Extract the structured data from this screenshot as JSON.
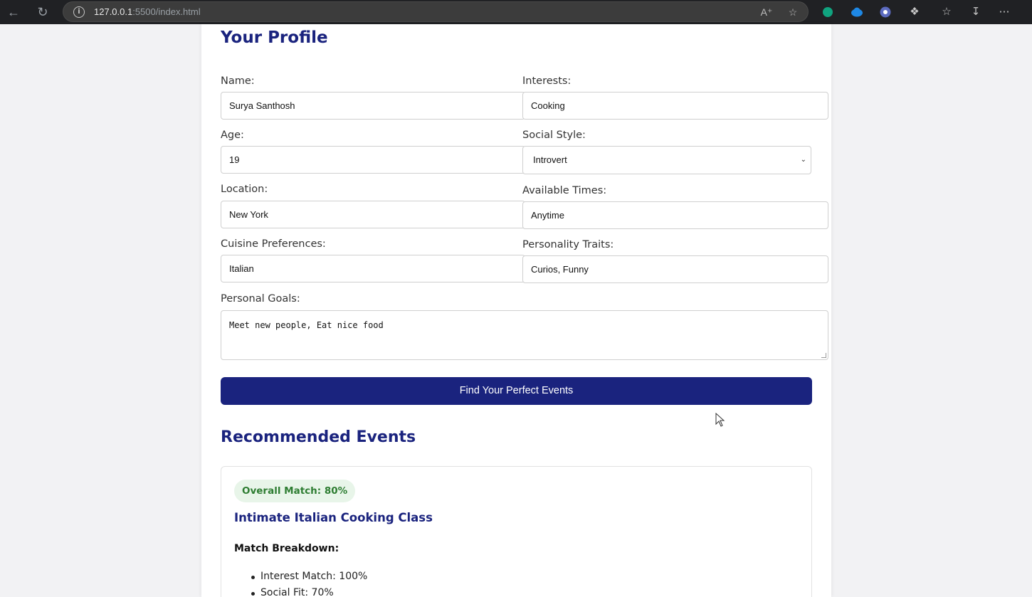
{
  "browser": {
    "url_host": "127.0.0.1",
    "url_rest": ":5500/index.html",
    "icons": [
      "back-icon",
      "refresh-icon",
      "info-icon",
      "read-aloud-icon",
      "favorite-star-icon",
      "extension-icon",
      "cloud-icon",
      "extension-icon-2",
      "extensions-puzzle-icon",
      "favorites-icon",
      "download-icon",
      "more-icon"
    ]
  },
  "profile": {
    "heading": "Your Profile",
    "name_label": "Name:",
    "name_value": "Surya Santhosh",
    "interests_label": "Interests:",
    "interests_value": "Cooking",
    "age_label": "Age:",
    "age_value": "19",
    "social_label": "Social Style:",
    "social_value": "Introvert",
    "location_label": "Location:",
    "location_value": "New York",
    "times_label": "Available Times:",
    "times_value": "Anytime",
    "cuisine_label": "Cuisine Preferences:",
    "cuisine_value": "Italian",
    "traits_label": "Personality Traits:",
    "traits_value": "Curios, Funny",
    "goals_label": "Personal Goals:",
    "goals_value": "Meet new people, Eat nice food",
    "submit_label": "Find Your Perfect Events"
  },
  "recommended": {
    "heading": "Recommended Events",
    "events": [
      {
        "match_badge": "Overall Match: 80%",
        "title": "Intimate Italian Cooking Class",
        "breakdown_label": "Match Breakdown:",
        "breakdown": [
          "Interest Match: 100%",
          "Social Fit: 70%"
        ]
      }
    ]
  },
  "colors": {
    "primary": "#1a237e",
    "badge_bg": "#e8f5e9",
    "badge_text": "#2e7d32"
  }
}
